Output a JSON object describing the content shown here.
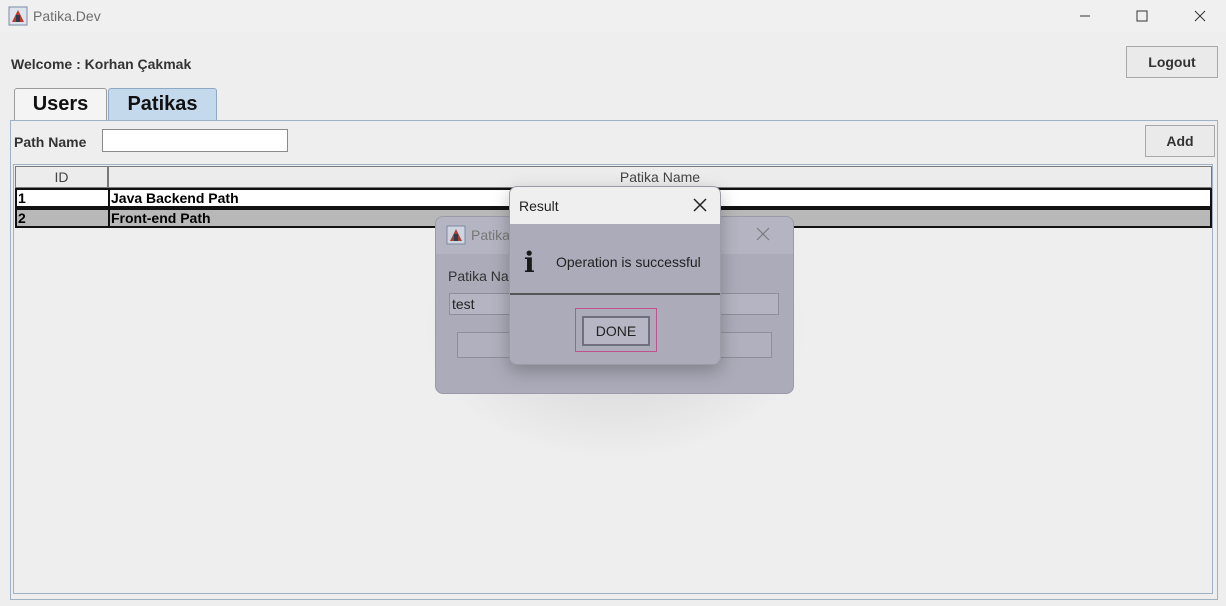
{
  "window": {
    "title": "Patika.Dev",
    "icon": "java-app-icon",
    "controls": [
      "minimize-icon",
      "maximize-icon",
      "close-icon"
    ]
  },
  "header": {
    "welcome": "Welcome : Korhan Çakmak",
    "logout_label": "Logout"
  },
  "tabs": [
    {
      "label": "Users",
      "selected": false
    },
    {
      "label": "Patikas",
      "selected": true
    }
  ],
  "form": {
    "path_label": "Path Name",
    "path_value": "",
    "add_label": "Add"
  },
  "table": {
    "columns": [
      "ID",
      "Patika Name"
    ],
    "rows": [
      {
        "id": "1",
        "name": "Java Backend Path",
        "selected": false
      },
      {
        "id": "2",
        "name": "Front-end Path",
        "selected": true
      }
    ]
  },
  "update_dialog": {
    "title": "Patika",
    "field_label": "Patika Na",
    "field_value": "test"
  },
  "result_dialog": {
    "title": "Result",
    "info_glyph": "i",
    "message": "Operation is successful",
    "button_label": "DONE"
  },
  "colors": {
    "selected_tab": "#c5d9ec",
    "selected_row": "#b8b8b8",
    "dialog_bg": "#ababb9",
    "focus_ring": "#c24f8e"
  }
}
